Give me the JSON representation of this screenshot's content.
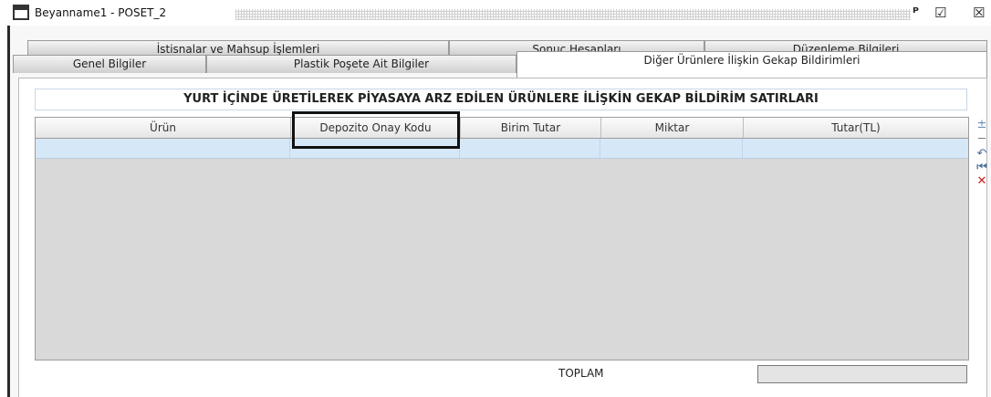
{
  "window": {
    "title": "Beyanname1 - POSET_2",
    "controls": {
      "restore": "ᴾ",
      "maximize": "☑",
      "close": "☒"
    }
  },
  "tabs": {
    "row1": [
      "İstisnalar ve Mahsup İşlemleri",
      "Sonuç Hesapları",
      "Düzenleme Bilgileri"
    ],
    "row2": [
      "Genel Bilgiler",
      "Plastik Poşete Ait Bilgiler",
      "Diğer Ürünlere İlişkin Gekap Bildirimleri"
    ],
    "active": "Diğer Ürünlere İlişkin Gekap Bildirimleri"
  },
  "section": {
    "title": "YURT İÇİNDE ÜRETİLEREK PİYASAYA ARZ EDİLEN ÜRÜNLERE İLİŞKİN GEKAP BİLDİRİM SATIRLARI"
  },
  "table": {
    "columns": [
      "Ürün",
      "Depozito Onay Kodu",
      "Birim Tutar",
      "Miktar",
      "Tutar(TL)"
    ],
    "rows": [
      [
        "",
        "",
        "",
        "",
        ""
      ]
    ]
  },
  "side_tools": [
    "add-row-icon",
    "remove-row-icon",
    "undo-icon",
    "first-row-icon",
    "delete-icon"
  ],
  "footer": {
    "total_label": "TOPLAM",
    "total_value": ""
  }
}
